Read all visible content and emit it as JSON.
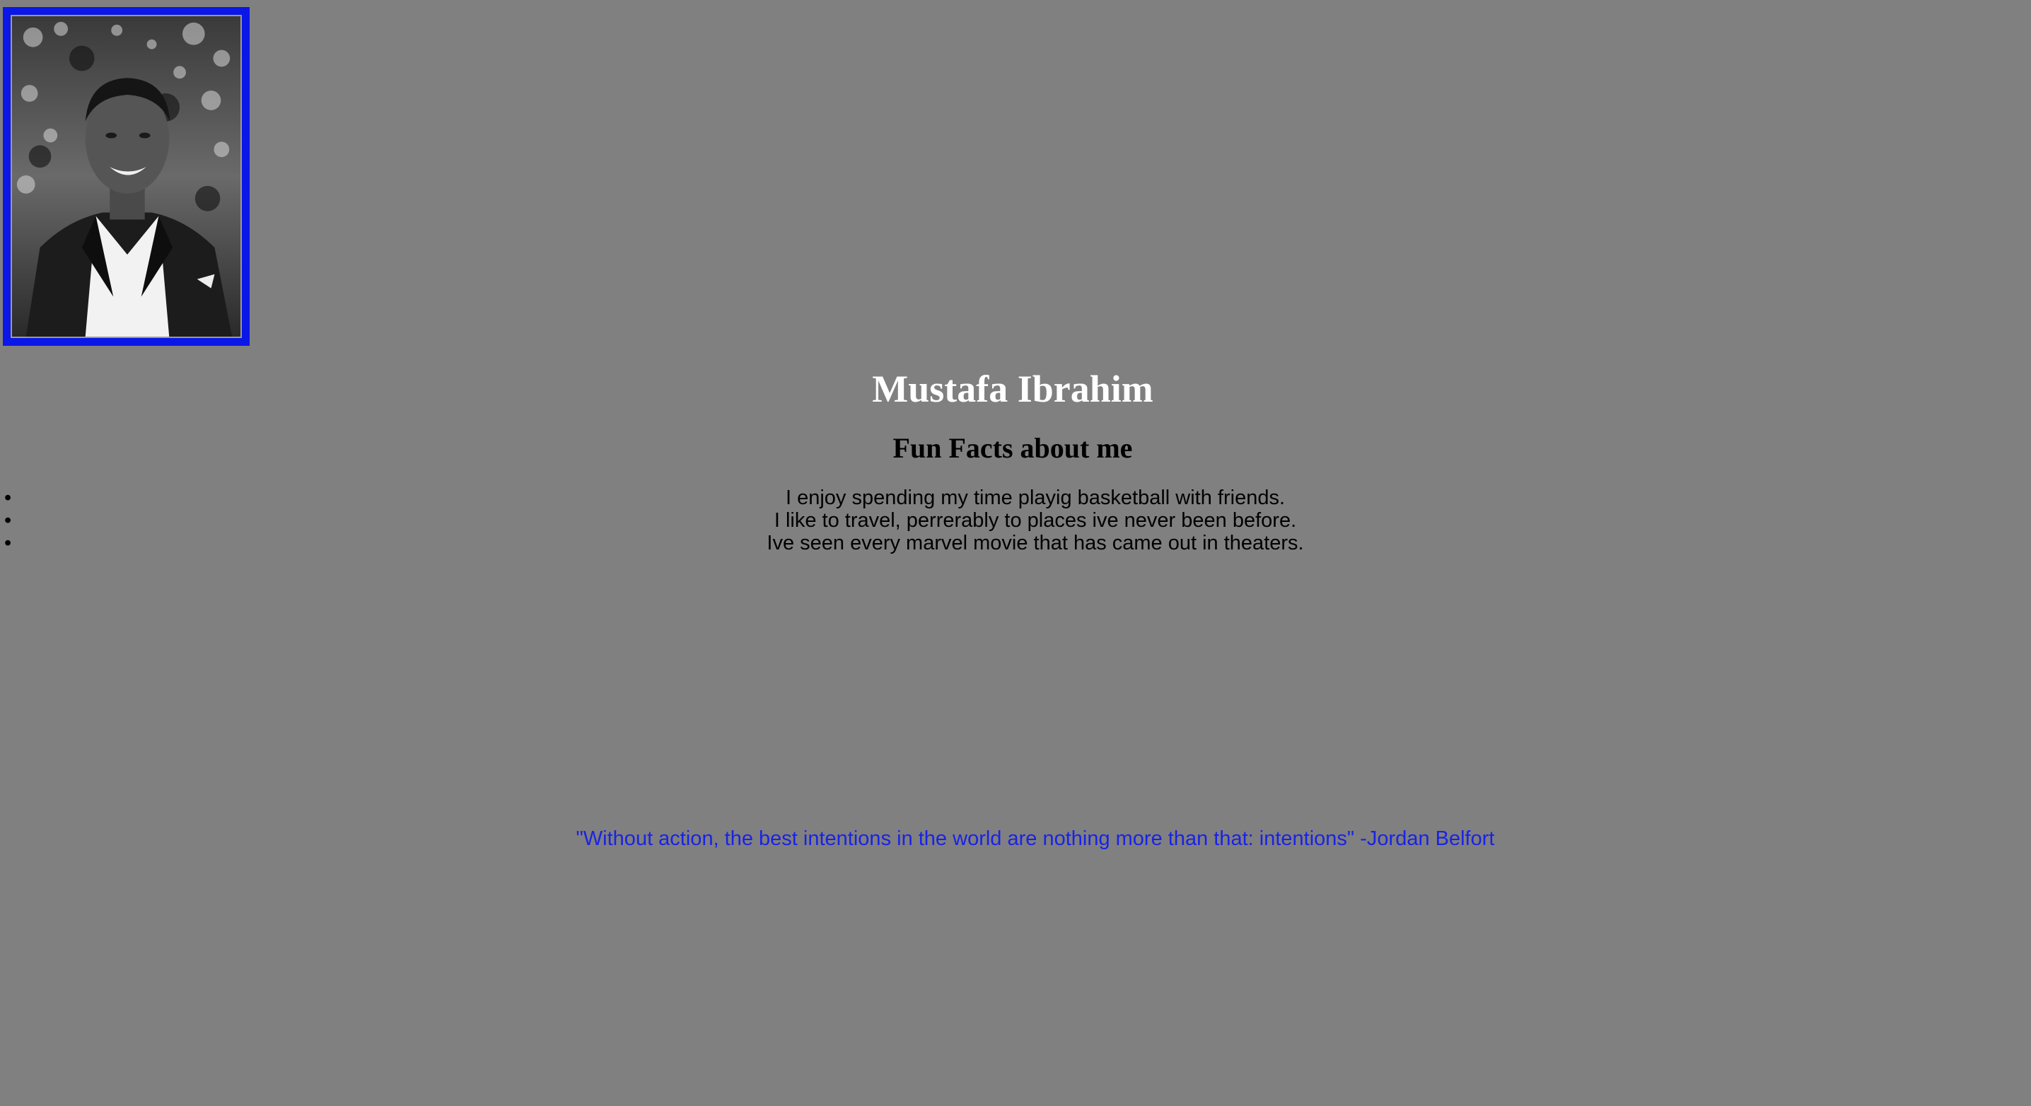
{
  "profile": {
    "photo_alt": "Portrait photo",
    "name": "Mustafa Ibrahim"
  },
  "fun_facts": {
    "heading": "Fun Facts about me",
    "items": [
      "I enjoy spending my time playig basketball with friends.",
      "I like to travel, perrerably to places ive never been before.",
      "Ive seen every marvel movie that has came out in theaters."
    ]
  },
  "quote": {
    "text": "\"Without action, the best intentions in the world are nothing more than that: intentions\" -Jordan Belfort"
  },
  "colors": {
    "background": "#808080",
    "frame": "#0a17e6",
    "quote": "#1a22e6",
    "name": "#ffffff"
  }
}
